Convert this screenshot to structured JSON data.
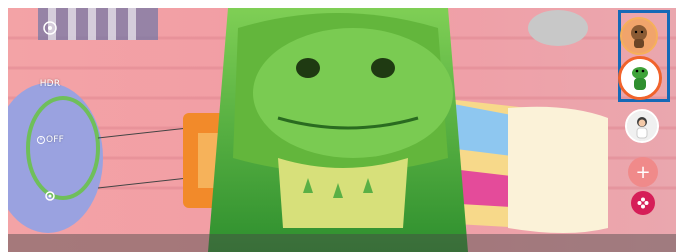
{
  "left_controls": {
    "top_icon": "settings-gear-icon",
    "hdr_label": "HDR",
    "timer_label": "OFF",
    "settings_icon": "gear-icon"
  },
  "stickers": {
    "items": [
      {
        "name": "bear-sticker",
        "selected": false
      },
      {
        "name": "dino-sticker",
        "selected": true
      },
      {
        "name": "person-sticker",
        "selected": false
      }
    ],
    "add_icon": "plus-icon",
    "flower_icon": "flower-icon"
  },
  "colors": {
    "highlight_border": "#1569b7",
    "selected_ring": "#f1632c",
    "flower_button": "#d61e58",
    "add_button": "#f08a8a"
  },
  "bottom_modes": [
    "",
    "",
    ""
  ]
}
